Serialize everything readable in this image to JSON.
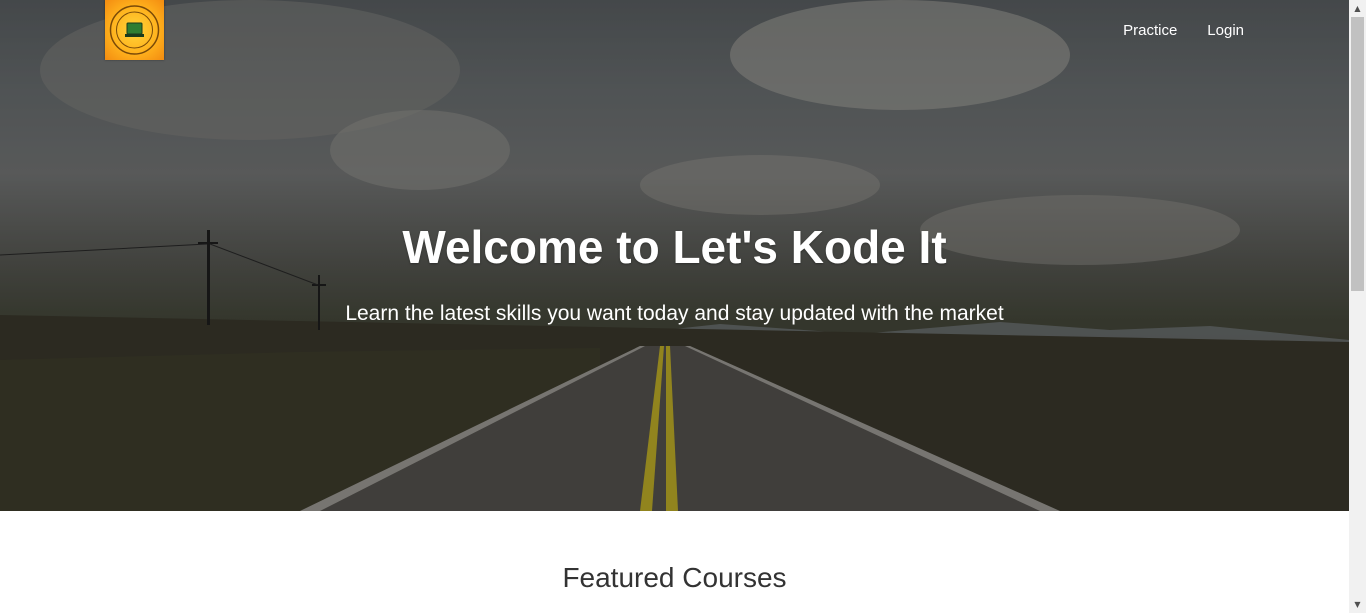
{
  "nav": {
    "items": [
      {
        "label": "Practice"
      },
      {
        "label": "Login"
      }
    ]
  },
  "hero": {
    "title": "Welcome to Let's Kode It",
    "subtitle": "Learn the latest skills you want today and stay updated with the market"
  },
  "featured": {
    "heading": "Featured Courses"
  },
  "logo": {
    "alt": "Let's Kode It logo"
  },
  "colors": {
    "logo_gold": "#ffb21d",
    "text_white": "#ffffff",
    "heading_dark": "#333333"
  }
}
